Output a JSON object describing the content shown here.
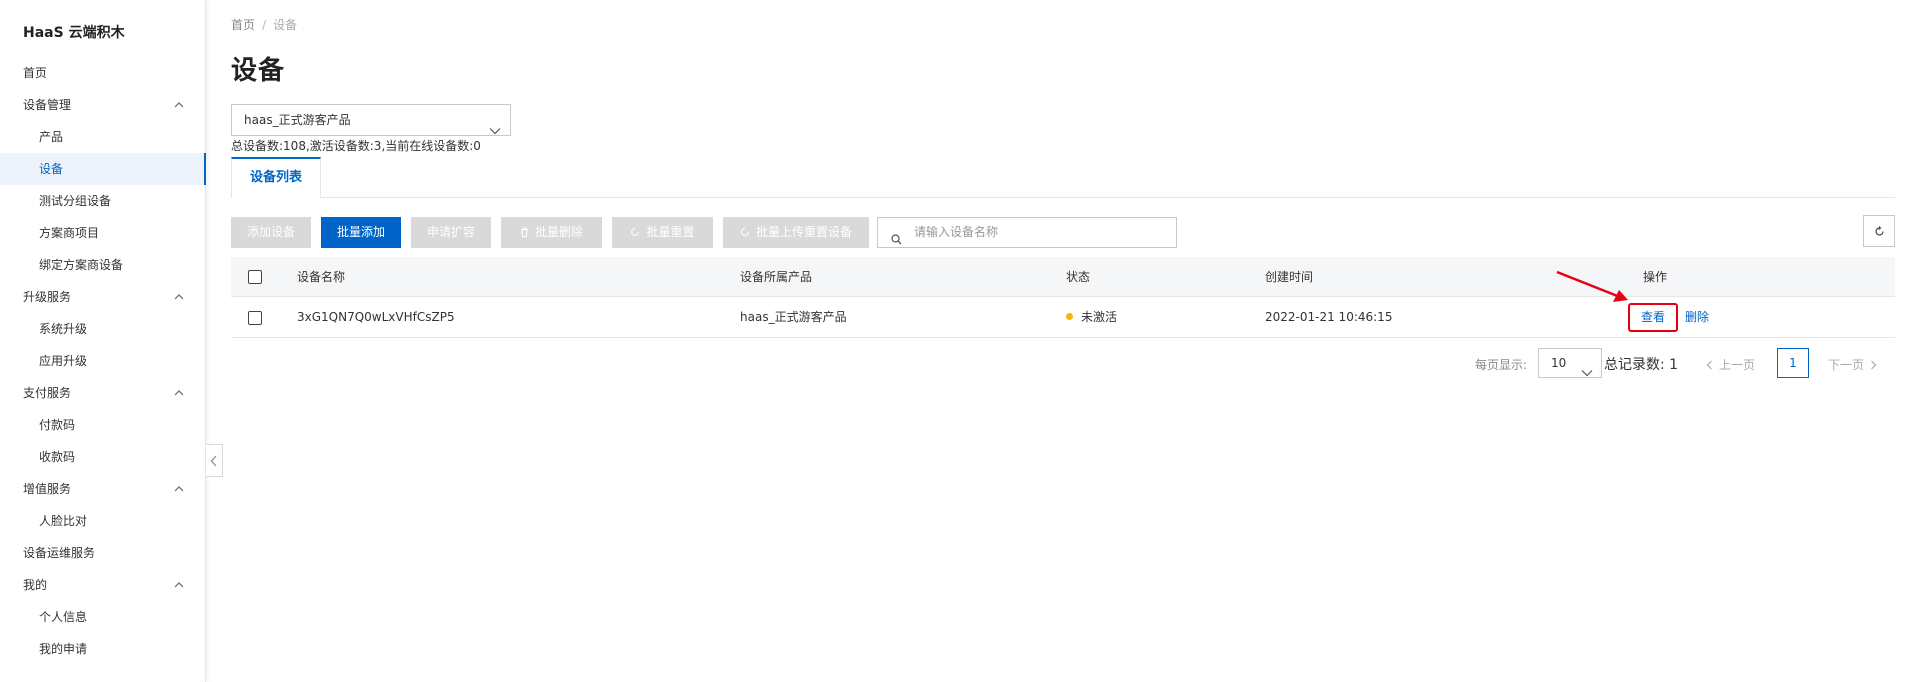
{
  "sidebar": {
    "brand": "HaaS 云端积木",
    "items": [
      {
        "label": "首页",
        "level": "top"
      },
      {
        "label": "设备管理",
        "level": "top",
        "expanded": true
      },
      {
        "label": "产品",
        "level": "sub"
      },
      {
        "label": "设备",
        "level": "sub",
        "active": true
      },
      {
        "label": "测试分组设备",
        "level": "sub"
      },
      {
        "label": "方案商项目",
        "level": "sub"
      },
      {
        "label": "绑定方案商设备",
        "level": "sub"
      },
      {
        "label": "升级服务",
        "level": "top",
        "expanded": true
      },
      {
        "label": "系统升级",
        "level": "sub"
      },
      {
        "label": "应用升级",
        "level": "sub"
      },
      {
        "label": "支付服务",
        "level": "top",
        "expanded": true
      },
      {
        "label": "付款码",
        "level": "sub"
      },
      {
        "label": "收款码",
        "level": "sub"
      },
      {
        "label": "增值服务",
        "level": "top",
        "expanded": true
      },
      {
        "label": "人脸比对",
        "level": "sub"
      },
      {
        "label": "设备运维服务",
        "level": "top"
      },
      {
        "label": "我的",
        "level": "top",
        "expanded": true
      },
      {
        "label": "个人信息",
        "level": "sub"
      },
      {
        "label": "我的申请",
        "level": "sub"
      }
    ]
  },
  "breadcrumb": {
    "home": "首页",
    "separator": "/",
    "current": "设备"
  },
  "page_title": "设备",
  "product_select": {
    "value": "haas_正式游客产品"
  },
  "stats": "总设备数:108,激活设备数:3,当前在线设备数:0",
  "tabs": [
    {
      "label": "设备列表",
      "active": true
    }
  ],
  "toolbar": {
    "add_device": "添加设备",
    "batch_add": "批量添加",
    "apply_expand": "申请扩容",
    "batch_delete": "批量删除",
    "batch_reset": "批量重置",
    "batch_upload_reset": "批量上传重置设备",
    "search_placeholder": "请输入设备名称"
  },
  "table": {
    "headers": {
      "name": "设备名称",
      "product": "设备所属产品",
      "status": "状态",
      "created": "创建时间",
      "actions": "操作"
    },
    "rows": [
      {
        "name": "3xG1QN7Q0wLxVHfCsZP5",
        "product": "haas_正式游客产品",
        "status": "未激活",
        "created": "2022-01-21 10:46:15",
        "view": "查看",
        "delete": "删除"
      }
    ]
  },
  "pagination": {
    "page_size_label": "每页显示:",
    "page_size": "10",
    "total": "总记录数: 1",
    "prev": "上一页",
    "current_page": "1",
    "next": "下一页"
  },
  "colors": {
    "primary": "#0064c8",
    "status_inactive": "#f5b800",
    "annotation": "#e60012"
  }
}
